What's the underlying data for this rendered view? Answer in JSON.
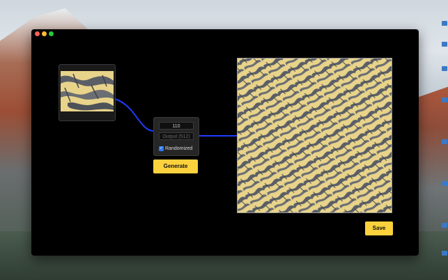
{
  "window": {
    "traffic_lights": [
      "close",
      "minimize",
      "zoom"
    ]
  },
  "controls": {
    "seed_value": "110",
    "output_placeholder": "Output (512)",
    "randomized_label": "Randomized",
    "randomized_checked": true
  },
  "buttons": {
    "generate": "Generate",
    "save": "Save"
  },
  "colors": {
    "accent": "#fbd23d",
    "link": "#1f3cff",
    "texture_light": "#e8d38a",
    "texture_dark": "#5a5e66"
  },
  "icons": [
    "checkmark-icon"
  ]
}
